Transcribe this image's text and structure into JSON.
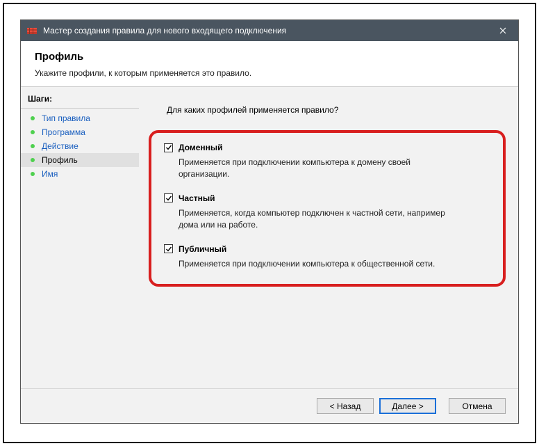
{
  "titlebar": {
    "title": "Мастер создания правила для нового входящего подключения"
  },
  "header": {
    "title": "Профиль",
    "subtitle": "Укажите профили, к которым применяется это правило."
  },
  "sidebar": {
    "heading": "Шаги:",
    "items": [
      {
        "label": "Тип правила"
      },
      {
        "label": "Программа"
      },
      {
        "label": "Действие"
      },
      {
        "label": "Профиль"
      },
      {
        "label": "Имя"
      }
    ]
  },
  "content": {
    "question": "Для каких профилей применяется правило?",
    "options": [
      {
        "label": "Доменный",
        "desc": "Применяется при подключении компьютера к домену своей организации."
      },
      {
        "label": "Частный",
        "desc": "Применяется, когда компьютер подключен к частной сети, например дома или на работе."
      },
      {
        "label": "Публичный",
        "desc": "Применяется при подключении компьютера к общественной сети."
      }
    ]
  },
  "footer": {
    "back": "< Назад",
    "next": "Далее >",
    "cancel": "Отмена"
  }
}
